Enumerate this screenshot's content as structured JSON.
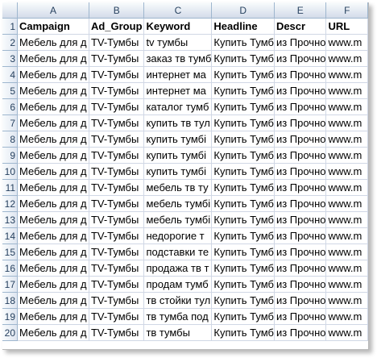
{
  "columns": [
    "A",
    "B",
    "C",
    "D",
    "E",
    "F"
  ],
  "header_row": {
    "row": "1",
    "cells": [
      "Campaign",
      "Ad_Group",
      "Keyword",
      "Headline",
      "Descr",
      "URL"
    ]
  },
  "rows": [
    {
      "row": "2",
      "cells": [
        "Мебель для д",
        "TV-Тумбы",
        "tv тумбы",
        "Купить Тумб",
        "из Прочно",
        "www.m"
      ]
    },
    {
      "row": "3",
      "cells": [
        "Мебель для д",
        "TV-Тумбы",
        "заказ тв тумб",
        "Купить Тумб",
        "из Прочно",
        "www.m"
      ]
    },
    {
      "row": "4",
      "cells": [
        "Мебель для д",
        "TV-Тумбы",
        "интернет ма",
        "Купить Тумб",
        "из Прочно",
        "www.m"
      ]
    },
    {
      "row": "5",
      "cells": [
        "Мебель для д",
        "TV-Тумбы",
        "интернет ма",
        "Купить Тумб",
        "из Прочно",
        "www.m"
      ]
    },
    {
      "row": "6",
      "cells": [
        "Мебель для д",
        "TV-Тумбы",
        "каталог тумб",
        "Купить Тумб",
        "из Прочно",
        "www.m"
      ]
    },
    {
      "row": "7",
      "cells": [
        "Мебель для д",
        "TV-Тумбы",
        "купить тв тул",
        "Купить Тумб",
        "из Прочно",
        "www.m"
      ]
    },
    {
      "row": "8",
      "cells": [
        "Мебель для д",
        "TV-Тумбы",
        "купить тумбі",
        "Купить Тумб",
        "из Прочно",
        "www.m"
      ]
    },
    {
      "row": "9",
      "cells": [
        "Мебель для д",
        "TV-Тумбы",
        "купить тумбі",
        "Купить Тумб",
        "из Прочно",
        "www.m"
      ]
    },
    {
      "row": "10",
      "cells": [
        "Мебель для д",
        "TV-Тумбы",
        "купить тумбі",
        "Купить Тумб",
        "из Прочно",
        "www.m"
      ]
    },
    {
      "row": "11",
      "cells": [
        "Мебель для д",
        "TV-Тумбы",
        "мебель тв ту",
        "Купить Тумб",
        "из Прочно",
        "www.m"
      ]
    },
    {
      "row": "12",
      "cells": [
        "Мебель для д",
        "TV-Тумбы",
        "мебель тумбі",
        "Купить Тумб",
        "из Прочно",
        "www.m"
      ]
    },
    {
      "row": "13",
      "cells": [
        "Мебель для д",
        "TV-Тумбы",
        "мебель тумбі",
        "Купить Тумб",
        "из Прочно",
        "www.m"
      ]
    },
    {
      "row": "14",
      "cells": [
        "Мебель для д",
        "TV-Тумбы",
        "недорогие т",
        "Купить Тумб",
        "из Прочно",
        "www.m"
      ]
    },
    {
      "row": "15",
      "cells": [
        "Мебель для д",
        "TV-Тумбы",
        "подставки те",
        "Купить Тумб",
        "из Прочно",
        "www.m"
      ]
    },
    {
      "row": "16",
      "cells": [
        "Мебель для д",
        "TV-Тумбы",
        "продажа тв т",
        "Купить Тумб",
        "из Прочно",
        "www.m"
      ]
    },
    {
      "row": "17",
      "cells": [
        "Мебель для д",
        "TV-Тумбы",
        "продам тумб",
        "Купить Тумб",
        "из Прочно",
        "www.m"
      ]
    },
    {
      "row": "18",
      "cells": [
        "Мебель для д",
        "TV-Тумбы",
        "тв стойки тул",
        "Купить Тумб",
        "из Прочно",
        "www.m"
      ]
    },
    {
      "row": "19",
      "cells": [
        "Мебель для д",
        "TV-Тумбы",
        "тв тумба под",
        "Купить Тумб",
        "из Прочно",
        "www.m"
      ]
    },
    {
      "row": "20",
      "cells": [
        "Мебель для д",
        "TV-Тумбы",
        "тв тумбы",
        "Купить Тумб",
        "из Прочно",
        "www.m"
      ]
    }
  ],
  "colors": {
    "header_bg": "#d3dbe9",
    "header_text": "#27415f",
    "gridline": "#d0d7e5"
  }
}
